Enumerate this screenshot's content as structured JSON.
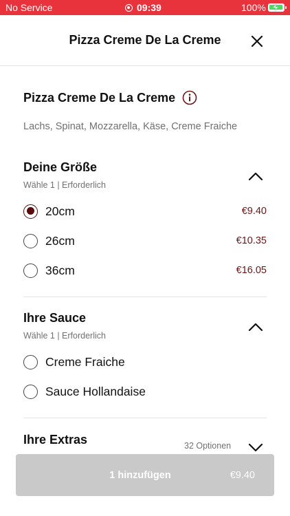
{
  "status_bar": {
    "carrier": "No Service",
    "time": "09:39",
    "battery": "100%"
  },
  "header": {
    "title": "Pizza Creme De La Creme",
    "close_icon": "close-icon"
  },
  "product": {
    "name": "Pizza Creme De La Creme",
    "info_icon": "info-icon",
    "description": "Lachs, Spinat, Mozzarella, Käse, Creme Fraiche"
  },
  "sections": [
    {
      "title": "Deine Größe",
      "subtitle": "Wähle 1  |  Erforderlich",
      "expanded": true,
      "options": [
        {
          "label": "20cm",
          "price": "€9.40",
          "selected": true
        },
        {
          "label": "26cm",
          "price": "€10.35",
          "selected": false
        },
        {
          "label": "36cm",
          "price": "€16.05",
          "selected": false
        }
      ]
    },
    {
      "title": "Ihre Sauce",
      "subtitle": "Wähle 1  |  Erforderlich",
      "expanded": true,
      "options": [
        {
          "label": "Creme Fraiche",
          "selected": false
        },
        {
          "label": "Sauce Hollandaise",
          "selected": false
        }
      ]
    },
    {
      "title": "Ihre Extras",
      "options_count": "32 Optionen",
      "expanded": false
    }
  ],
  "footer": {
    "add_label": "1 hinzufügen",
    "add_price": "€9.40"
  },
  "colors": {
    "status_bar": "#e8323c",
    "accent": "#5a0a0a",
    "price": "#6b1515",
    "button_disabled": "#c9c9c9",
    "battery_charge": "#4cd964"
  }
}
